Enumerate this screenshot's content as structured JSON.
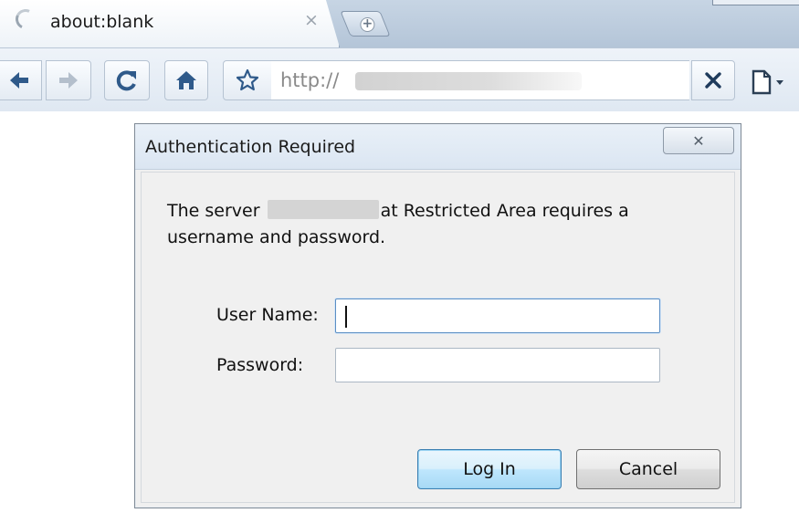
{
  "browser": {
    "tab": {
      "title": "about:blank",
      "close_glyph": "×"
    },
    "new_tab_glyph": "+",
    "omnibox": {
      "url_prefix": "http://"
    },
    "stop_glyph": "✕",
    "icons": [
      "back-icon",
      "forward-icon",
      "reload-icon",
      "home-icon",
      "star-icon",
      "stop-icon",
      "page-menu-icon"
    ]
  },
  "dialog": {
    "title": "Authentication Required",
    "close_glyph": "✕",
    "message_prefix": "The server",
    "message_suffix": "at Restricted Area requires a username and password.",
    "username_label": "User Name:",
    "username_value": "",
    "password_label": "Password:",
    "password_value": "",
    "login_label": "Log In",
    "cancel_label": "Cancel"
  },
  "colors": {
    "chrome_frame": "#c7d5e4",
    "toolbar": "#e4ecf5",
    "arrow_blue": "#2f5a8a",
    "dialog_bg": "#f0f0f0",
    "default_button": "#bee6fd",
    "stop_icon": "#1f3b5c"
  }
}
